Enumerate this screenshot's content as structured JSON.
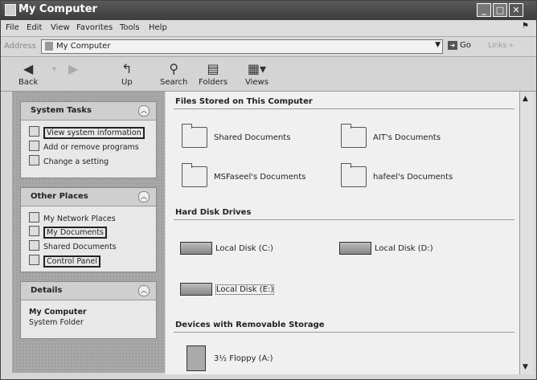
{
  "window": {
    "title": "My Computer"
  },
  "menu": {
    "file": "File",
    "edit": "Edit",
    "view": "View",
    "favorites": "Favorites",
    "tools": "Tools",
    "help": "Help"
  },
  "address": {
    "label": "Address",
    "value": "My Computer",
    "go": "Go",
    "links": "Links"
  },
  "toolbar": {
    "back": "Back",
    "forward": "",
    "up": "Up",
    "search": "Search",
    "folders": "Folders",
    "views": "Views"
  },
  "system_tasks": {
    "title": "System Tasks",
    "items": [
      "View system information",
      "Add or remove programs",
      "Change a setting"
    ]
  },
  "other_places": {
    "title": "Other Places",
    "items": [
      "My Network Places",
      "My Documents",
      "Shared Documents",
      "Control Panel"
    ]
  },
  "details": {
    "title": "Details",
    "name": "My Computer",
    "type": "System Folder"
  },
  "sections": {
    "files": "Files Stored on This Computer",
    "hdd": "Hard Disk Drives",
    "removable": "Devices with Removable Storage"
  },
  "folders": [
    "Shared Documents",
    "AIT's Documents",
    "MSFaseel's Documents",
    "hafeel's Documents"
  ],
  "disks": [
    "Local Disk (C:)",
    "Local Disk (D:)",
    "Local Disk (E:)"
  ],
  "removable": [
    "3½ Floppy (A:)"
  ]
}
